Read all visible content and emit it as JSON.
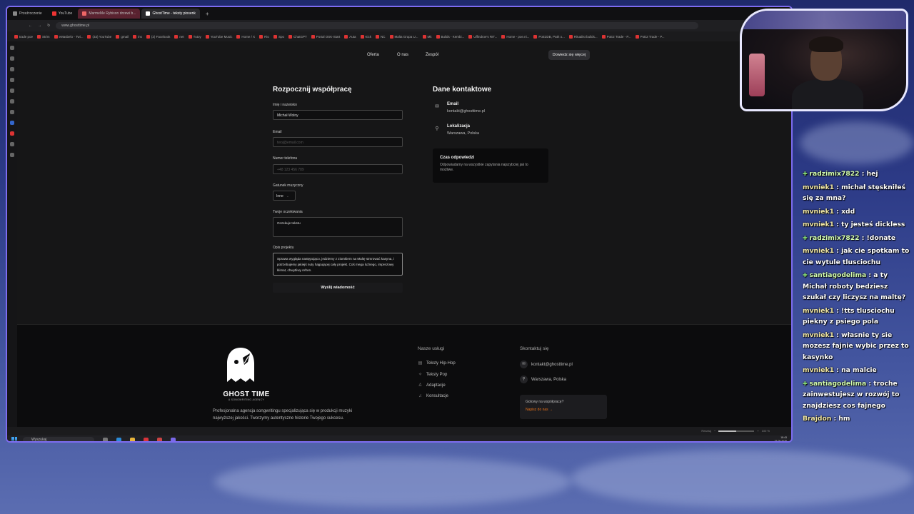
{
  "browser": {
    "tabs": [
      "Przeźroczenie",
      "YouTube",
      "MarmeMe Rybison drzewi b...",
      "GhostTime - teksty piosenk"
    ],
    "url": "www.ghosttime.pl",
    "bookmarks": [
      "trade poe",
      "Strim",
      "eMasbelo - Twi...",
      "(33) YouTube",
      "gmail",
      "ins",
      "(2) Facebook",
      "net",
      "Tutoy",
      "YouTube Music",
      "Home / X",
      "Rio",
      "Spo",
      "ChatGPT",
      "Portal OSK-Start",
      "Auta",
      "Kick",
      "NC",
      "Malta Grupa U...",
      "Mit",
      "Builds - Kembi...",
      "Uffindroe's RIT...",
      "Home - poe.ni...",
      "PoE2DB, Path o...",
      "Ritualist builds...",
      "PoE2 Trade - P...",
      "PoE2 Trade - P..."
    ]
  },
  "nav": {
    "links": [
      "Oferta",
      "O nas",
      "Zespół"
    ],
    "cta": "Dowiedz się więcej"
  },
  "form": {
    "title": "Rozpocznij współpracę",
    "name_label": "Imię i nazwisko",
    "name_value": "Michał Wolny",
    "email_label": "Email",
    "email_placeholder": "twoj@email.com",
    "phone_label": "Numer telefonu",
    "phone_placeholder": "+48 123 456 789",
    "genre_label": "Gatunek muzyczny",
    "genre_value": "Inne",
    "expect_label": "Twoje oczekiwania",
    "expect_value": "Oczekuje tekstu",
    "project_label": "Opis projektu",
    "project_value": "Sprawa wygląda następująco, jedziemy z ziomkiem na Maltę stmrować kasyna, i potrzebujemy jakiejś nuty hajpującej cały projekt. Coś mega luźnego, imprezowy klimat, chwytliwy refren.",
    "submit": "Wyślij wiadomość"
  },
  "contact": {
    "title": "Dane kontaktowe",
    "email_label": "Email",
    "email_value": "kontakt@ghosttime.pl",
    "location_label": "Lokalizacja",
    "location_value": "Warszawa, Polska",
    "response_title": "Czas odpowiedzi",
    "response_text": "Odpowiadamy na wszystkie zapytania najszybciej jak to możliwe."
  },
  "footer": {
    "brand": "GHOST TIME",
    "brand_sub": "A SONGWRITING AGENCY",
    "description": "Profesjonalna agencja songwritingu specjalizująca się w produkcji muzyki najwyższej jakości. Tworzymy autentyczne historie Twojego sukcesu.",
    "services_title": "Nasze usługi",
    "services": [
      "Teksty Hip-Hop",
      "Teksty Pop",
      "Adaptacje",
      "Konsultacje"
    ],
    "contact_title": "Skontaktuj się",
    "contact_email": "kontakt@ghosttime.pl",
    "contact_location": "Warszawa, Polska",
    "ready_title": "Gotowy na współpracę?",
    "ready_link": "Napisz do nas →"
  },
  "status": {
    "reset": "Resetuj",
    "zoom": "100 %",
    "zoom_fraction": 0.5
  },
  "taskbar": {
    "search": "Wyszukaj",
    "time": "18:43",
    "date": "15.08.2025"
  },
  "chat": [
    {
      "user": "radzimix7822",
      "text": "hej",
      "sub": true
    },
    {
      "user": "mvniek1",
      "text": "michał stęskniłeś się za mna?",
      "sub": false
    },
    {
      "user": "mvniek1",
      "text": "xdd",
      "sub": false
    },
    {
      "user": "mvniek1",
      "text": "ty jesteś dickless",
      "sub": false
    },
    {
      "user": "radzimix7822",
      "text": "!donate",
      "sub": true
    },
    {
      "user": "mvniek1",
      "text": "jak cie spotkam to cie wytule tlusciochu",
      "sub": false
    },
    {
      "user": "santiagodelima",
      "text": "a ty Michał roboty bedziesz szukał czy liczysz na maltę?",
      "sub": true
    },
    {
      "user": "mvniek1",
      "text": "!tts tlusciochu piekny z psiego pola",
      "sub": false
    },
    {
      "user": "mvniek1",
      "text": "własnie ty sie mozesz fajnie wybic przez to kasynko",
      "sub": false
    },
    {
      "user": "mvniek1",
      "text": "na malcie",
      "sub": false
    },
    {
      "user": "santiagodelima",
      "text": "troche zainwestujesz w rozwój to znajdziesz cos fajnego",
      "sub": true
    },
    {
      "user": "Brajdon",
      "text": "hm",
      "sub": false
    }
  ]
}
